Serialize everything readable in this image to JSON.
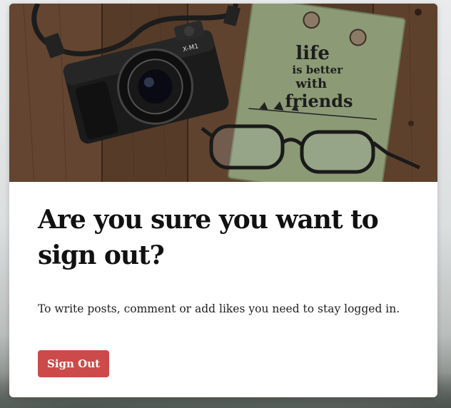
{
  "hero": {
    "notebook_text": [
      "life",
      "is better",
      "with",
      "friends"
    ],
    "camera_badge": "X-M1"
  },
  "dialog": {
    "title": "Are you sure you want to sign out?",
    "message": "To write posts, comment or add likes you need to stay logged in.",
    "signout_label": "Sign Out"
  },
  "colors": {
    "accent": "#cd4a4a",
    "card_background": "#ffffff",
    "title_text": "#111111"
  }
}
